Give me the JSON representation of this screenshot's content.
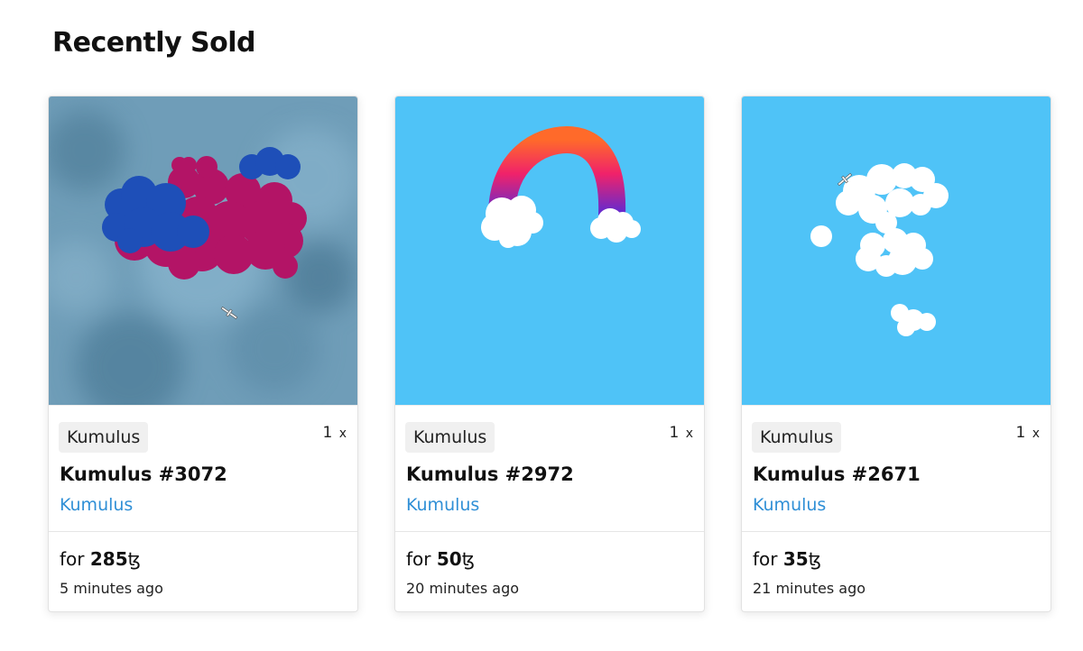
{
  "section": {
    "title": "Recently Sold"
  },
  "cards": [
    {
      "tag": "Kumulus",
      "quantity": "1",
      "quantity_suffix": "x",
      "name": "Kumulus #3072",
      "collection": "Kumulus",
      "price_prefix": "for",
      "price": "285",
      "currency": "ꜩ",
      "time": "5 minutes ago",
      "art_bg": "#6e9bb5"
    },
    {
      "tag": "Kumulus",
      "quantity": "1",
      "quantity_suffix": "x",
      "name": "Kumulus #2972",
      "collection": "Kumulus",
      "price_prefix": "for",
      "price": "50",
      "currency": "ꜩ",
      "time": "20 minutes ago",
      "art_bg": "#4fc3f7"
    },
    {
      "tag": "Kumulus",
      "quantity": "1",
      "quantity_suffix": "x",
      "name": "Kumulus #2671",
      "collection": "Kumulus",
      "price_prefix": "for",
      "price": "35",
      "currency": "ꜩ",
      "time": "21 minutes ago",
      "art_bg": "#4fc3f7"
    }
  ],
  "colors": {
    "link": "#2f8fd6",
    "tag_bg": "#f0f0f0"
  }
}
